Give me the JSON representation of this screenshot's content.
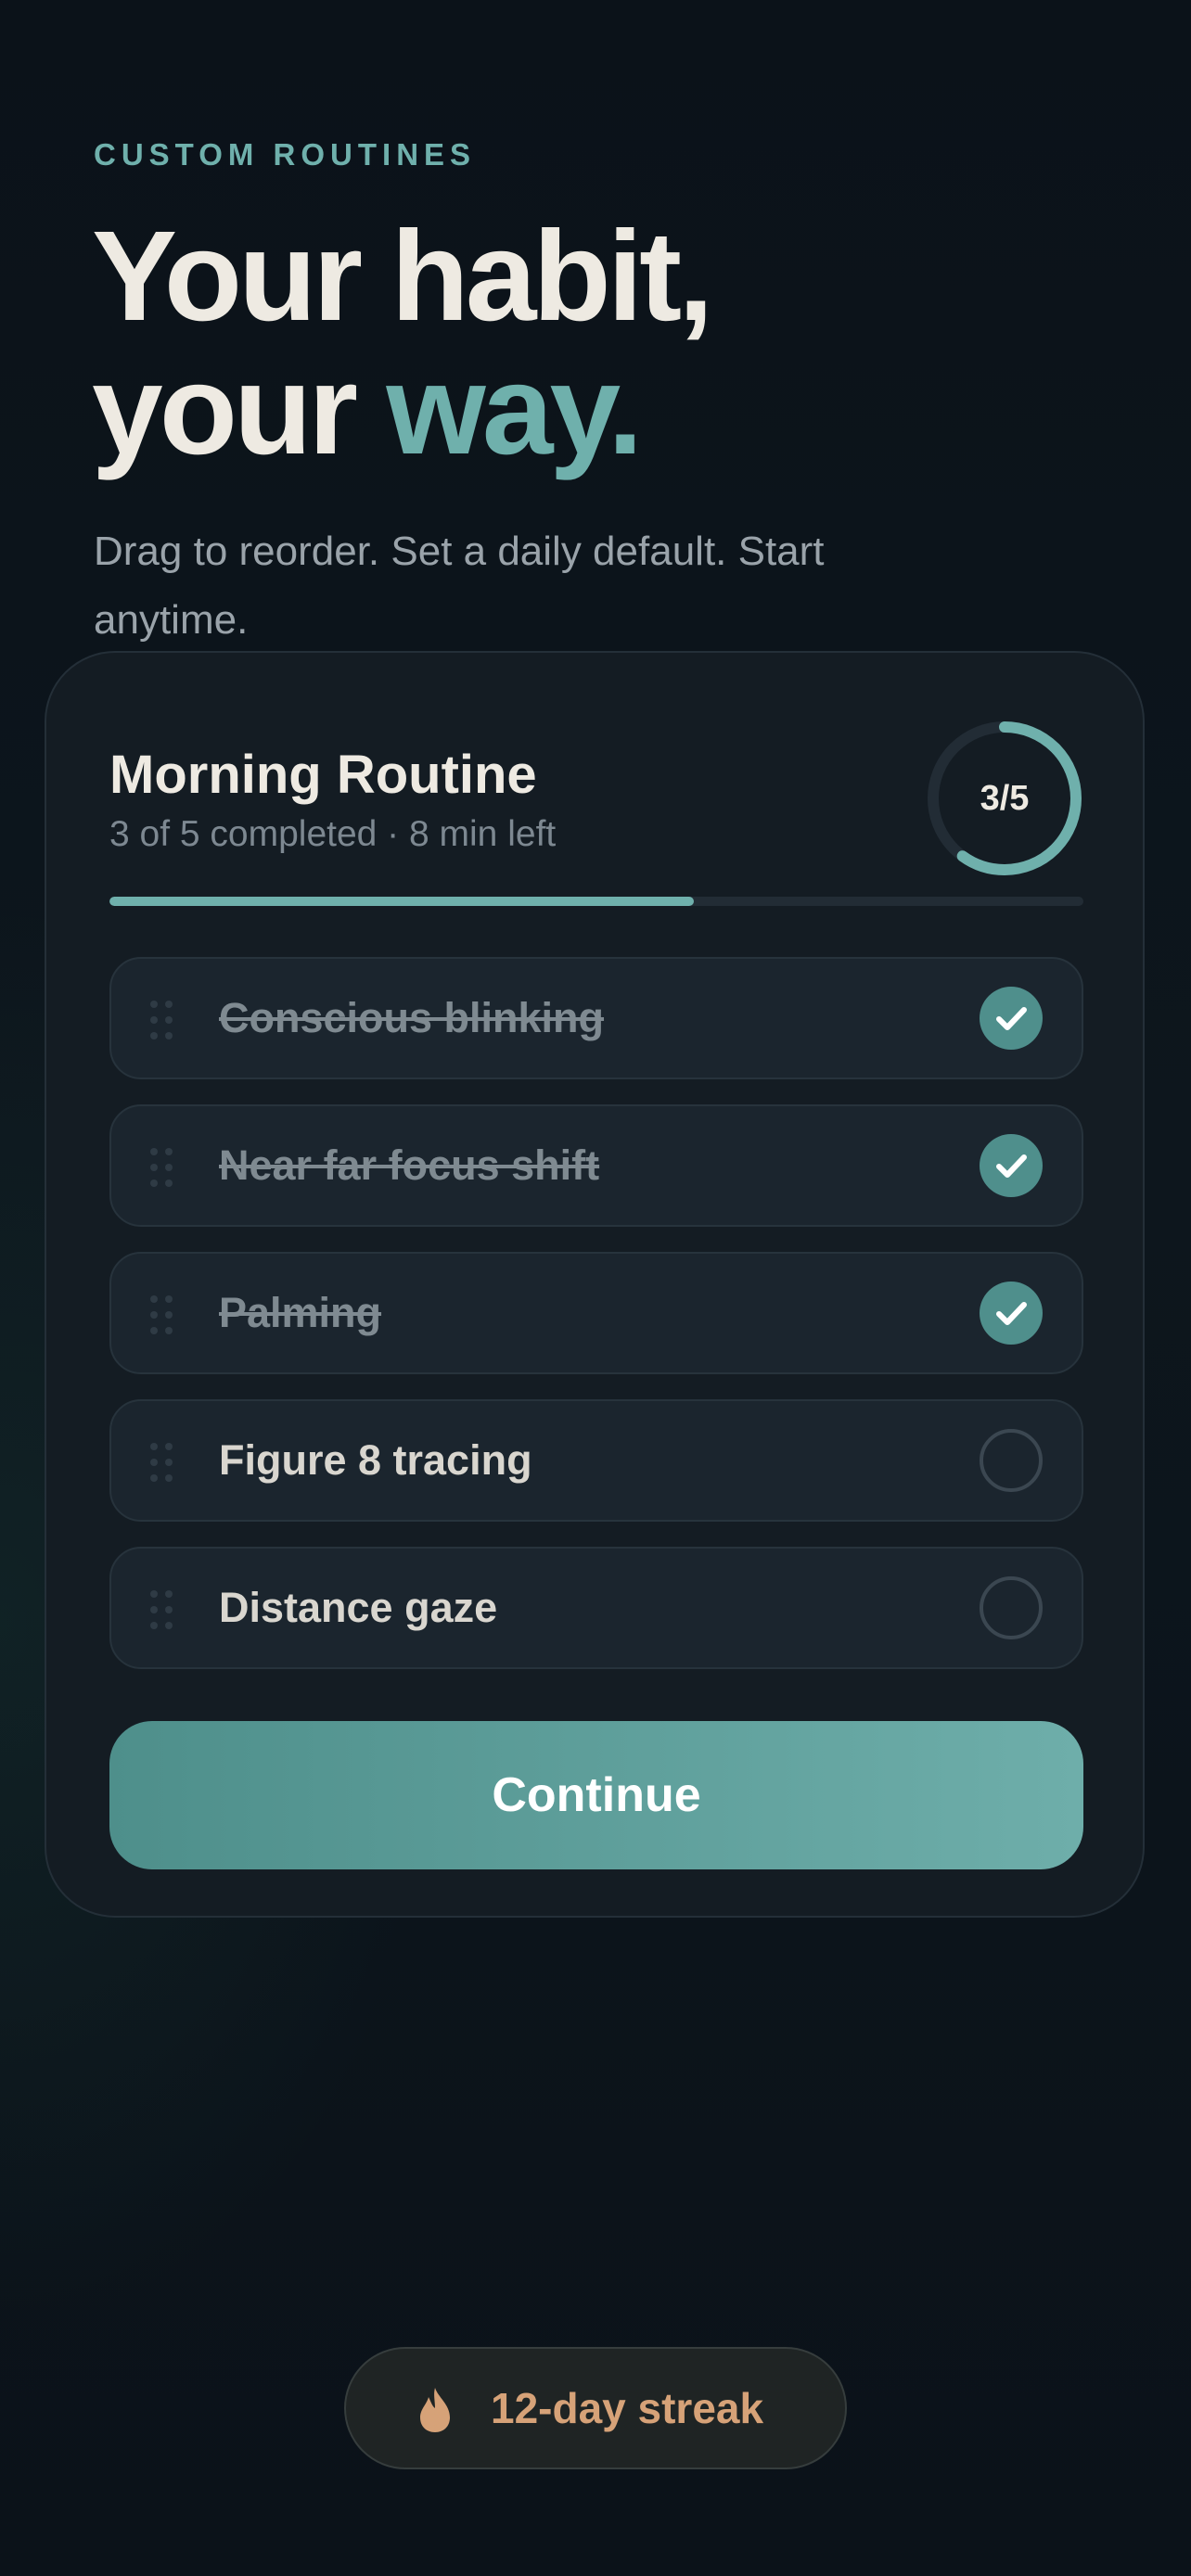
{
  "header": {
    "eyebrow": "CUSTOM ROUTINES",
    "title_line1": "Your habit,",
    "title_line2_prefix": "your ",
    "title_line2_accent": "way.",
    "subtitle": "Drag to reorder. Set a daily default. Start anytime."
  },
  "routine": {
    "title": "Morning Routine",
    "meta": "3 of 5 completed · 8 min left",
    "progress_label": "3/5",
    "completed": 3,
    "total": 5,
    "items": [
      {
        "label": "Conscious blinking",
        "done": true
      },
      {
        "label": "Near far focus shift",
        "done": true
      },
      {
        "label": "Palming",
        "done": true
      },
      {
        "label": "Figure 8 tracing",
        "done": false
      },
      {
        "label": "Distance gaze",
        "done": false
      }
    ],
    "continue_label": "Continue"
  },
  "streak": {
    "label": "12-day streak",
    "icon": "flame-icon"
  },
  "colors": {
    "accent": "#6fb0ac",
    "check_fill": "#4f8f8c",
    "streak_text": "#d6a278",
    "text": "#eeeae2"
  }
}
